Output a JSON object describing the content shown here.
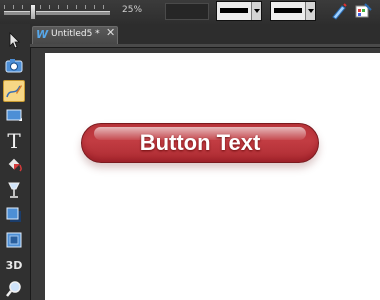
{
  "topbar": {
    "zoom_label": "25%",
    "zoom_value": 0.25,
    "line_style_1": "solid-line",
    "line_style_2": "solid-line",
    "icons": [
      "pen-pencil-icon",
      "color-editor-icon"
    ]
  },
  "toolbar": {
    "tools": [
      {
        "name": "selector-tool",
        "glyph": "➤"
      },
      {
        "name": "photo-tool",
        "glyph": "📷"
      },
      {
        "name": "freehand-pen-tool",
        "glyph": "✎"
      },
      {
        "name": "rectangle-tool",
        "glyph": "▬"
      },
      {
        "name": "text-tool",
        "glyph": "T"
      },
      {
        "name": "fill-tool",
        "glyph": "◆"
      },
      {
        "name": "transparency-tool",
        "glyph": "🍷"
      },
      {
        "name": "shadow-tool",
        "glyph": "◪"
      },
      {
        "name": "bevel-tool",
        "glyph": "▣"
      },
      {
        "name": "3d-tool",
        "glyph": "3D"
      },
      {
        "name": "zoom-tool",
        "glyph": "🔍"
      }
    ],
    "active_tool": "freehand-pen-tool"
  },
  "document": {
    "app_icon": "W",
    "tab_title": "Untitled5 *",
    "close_glyph": "✕"
  },
  "canvas": {
    "button_text": "Button Text",
    "button_color": "#c03a40"
  }
}
